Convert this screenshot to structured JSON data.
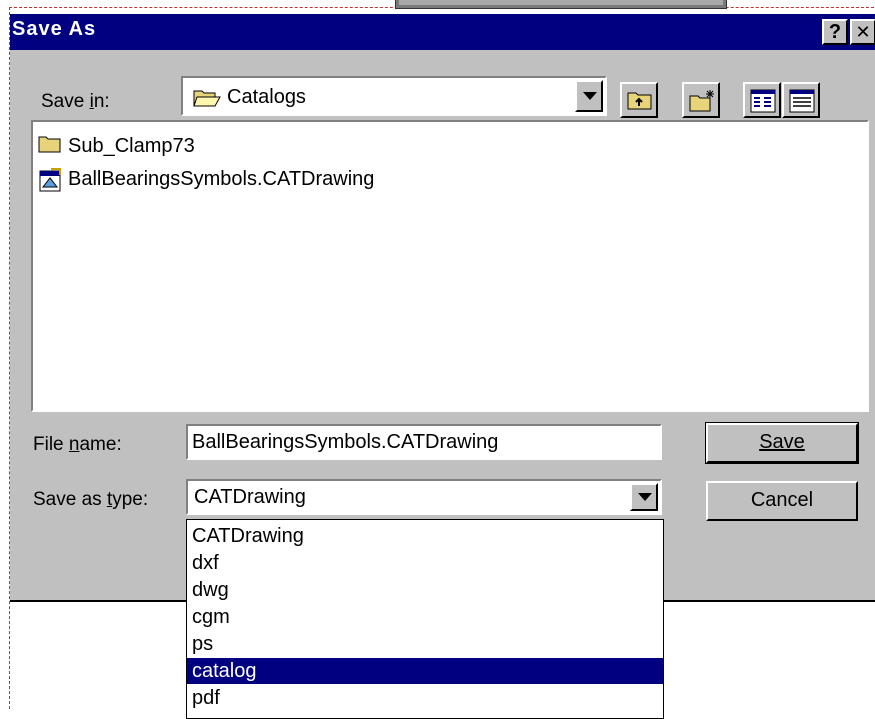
{
  "dialog": {
    "title": "Save As",
    "help_glyph": "?",
    "close_glyph": "✕"
  },
  "save_in": {
    "label": "Save in:",
    "value": "Catalogs",
    "icon": "folder-open-icon"
  },
  "toolbar": {
    "buttons": [
      "up-one-level-icon",
      "create-new-folder-icon",
      "list-view-icon",
      "details-view-icon"
    ]
  },
  "file_list": {
    "items": [
      {
        "label": "Sub_Clamp73",
        "icon": "folder-icon"
      },
      {
        "label": "BallBearingsSymbols.CATDrawing",
        "icon": "catdrawing-file-icon"
      }
    ]
  },
  "file_name": {
    "label": "File name:",
    "value": "BallBearingsSymbols.CATDrawing"
  },
  "save_as_type": {
    "label": "Save as type:",
    "value": "CATDrawing",
    "options": [
      "CATDrawing",
      "dxf",
      "dwg",
      "cgm",
      "ps",
      "catalog",
      "pdf"
    ],
    "highlighted": "catalog"
  },
  "buttons": {
    "save": "Save",
    "cancel": "Cancel"
  },
  "colors": {
    "titlebar": "#000080",
    "face": "#c0c0c0",
    "highlight": "#000080"
  }
}
